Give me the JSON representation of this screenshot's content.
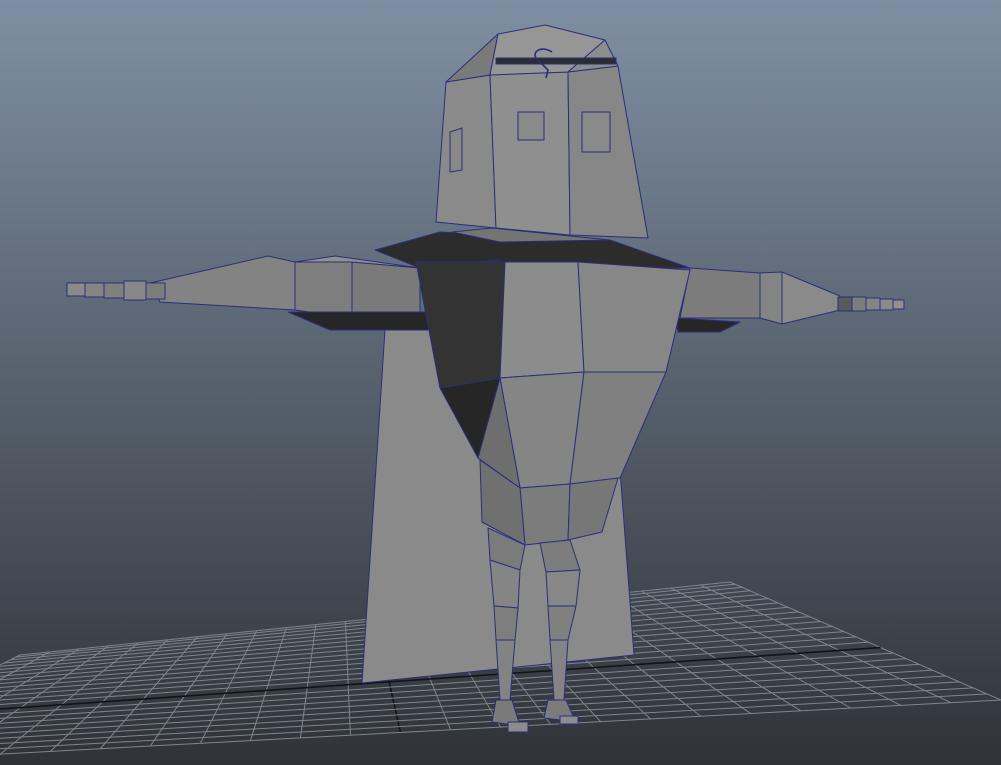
{
  "viewport": {
    "mode": "perspective",
    "shading": "smooth-shade-with-wireframe-on-shaded",
    "background": {
      "top": "#7f8fa3",
      "bottom": "#2f3338"
    },
    "grid": {
      "visible": true,
      "color": "#7f858c",
      "axis_color": "#111317"
    },
    "wireframe_color": "#2a2f7a"
  },
  "model": {
    "pose": "t-pose",
    "surface_colors": {
      "light": "#8e8e8e",
      "mid": "#7a7a7a",
      "dark": "#5a5a5a",
      "shadow": "#2a2a2a"
    }
  }
}
